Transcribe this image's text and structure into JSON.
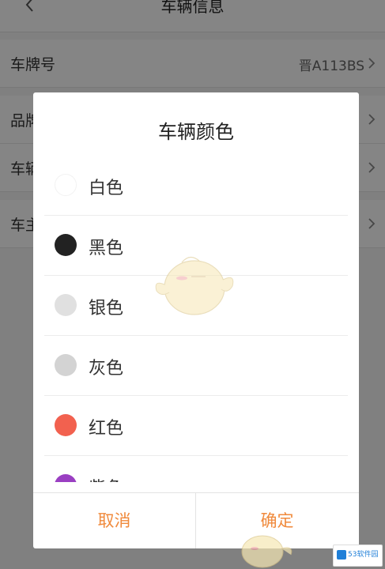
{
  "header": {
    "title": "车辆信息"
  },
  "info_rows": [
    {
      "label": "车牌号",
      "value": "晋A113BS"
    },
    {
      "label": "品牌",
      "value": ""
    },
    {
      "label": "车辆",
      "value": ""
    },
    {
      "label": "车主",
      "value": ""
    }
  ],
  "dialog": {
    "title": "车辆颜色",
    "colors": [
      {
        "label": "白色",
        "swatch": "#ffffff"
      },
      {
        "label": "黑色",
        "swatch": "#222222"
      },
      {
        "label": "银色",
        "swatch": "#e0e0e0"
      },
      {
        "label": "灰色",
        "swatch": "#d3d3d3"
      },
      {
        "label": "红色",
        "swatch": "#f2614f"
      },
      {
        "label": "紫色",
        "swatch": "#9a3fc2"
      }
    ],
    "cancel_label": "取消",
    "confirm_label": "确定"
  },
  "watermark": {
    "site_text": "53软件园"
  },
  "theme": {
    "accent": "#f08a3c",
    "overlay": "rgba(0,0,0,0.48)"
  }
}
